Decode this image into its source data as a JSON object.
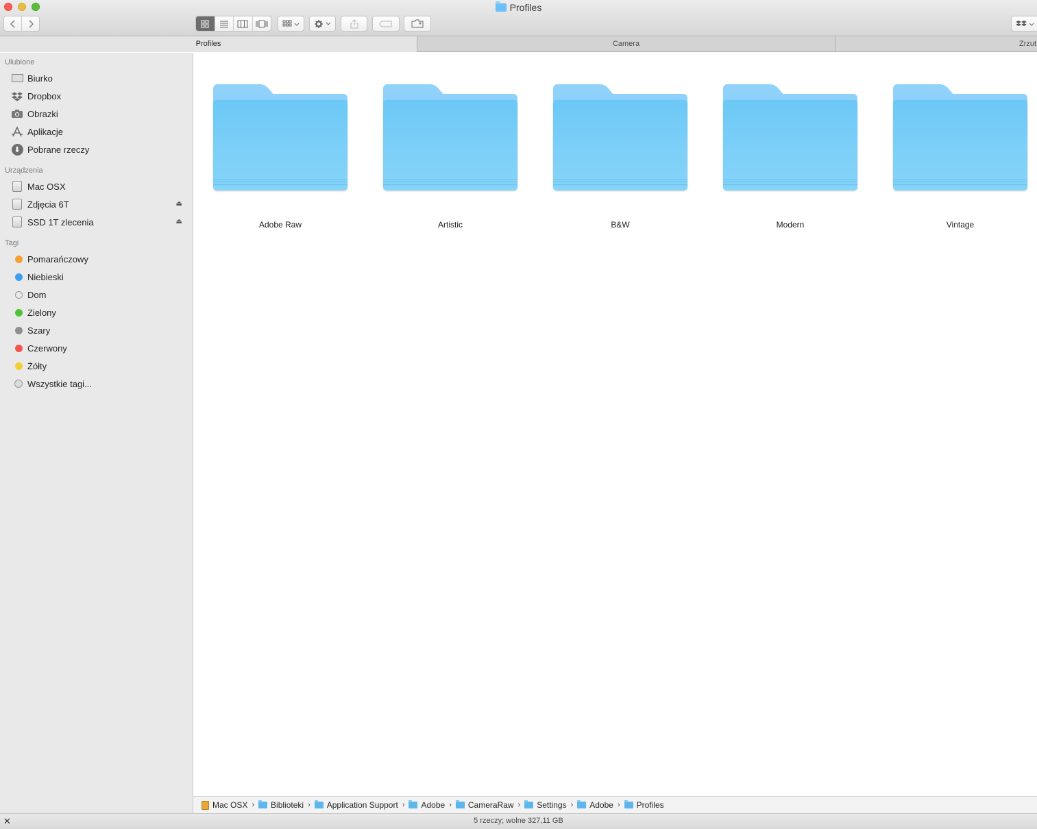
{
  "window": {
    "title": "Profiles"
  },
  "tabs": [
    {
      "label": "Profiles",
      "active": true
    },
    {
      "label": "Camera",
      "active": false
    },
    {
      "label": "Zrzut",
      "active": false
    }
  ],
  "sidebar": {
    "favorites_title": "Ulubione",
    "favorites": [
      {
        "label": "Biurko",
        "icon": "desktop-icon"
      },
      {
        "label": "Dropbox",
        "icon": "dropbox-icon"
      },
      {
        "label": "Obrazki",
        "icon": "camera-icon"
      },
      {
        "label": "Aplikacje",
        "icon": "applications-icon"
      },
      {
        "label": "Pobrane rzeczy",
        "icon": "download-icon"
      }
    ],
    "devices_title": "Urządzenia",
    "devices": [
      {
        "label": "Mac OSX",
        "ejectable": false
      },
      {
        "label": "Zdjęcia 6T",
        "ejectable": true
      },
      {
        "label": "SSD 1T zlecenia",
        "ejectable": true
      }
    ],
    "tags_title": "Tagi",
    "tags": [
      {
        "label": "Pomarańczowy",
        "color": "#f5a031"
      },
      {
        "label": "Niebieski",
        "color": "#3b9ef2"
      },
      {
        "label": "Dom",
        "color": "none"
      },
      {
        "label": "Zielony",
        "color": "#53c23b"
      },
      {
        "label": "Szary",
        "color": "#8f8f8f"
      },
      {
        "label": "Czerwony",
        "color": "#f2564f"
      },
      {
        "label": "Żółty",
        "color": "#f5cd34"
      },
      {
        "label": "Wszystkie tagi...",
        "color": "all"
      }
    ]
  },
  "folders": [
    {
      "name": "Adobe Raw"
    },
    {
      "name": "Artistic"
    },
    {
      "name": "B&W"
    },
    {
      "name": "Modern"
    },
    {
      "name": "Vintage"
    }
  ],
  "path": [
    {
      "label": "Mac OSX",
      "icon": "drive"
    },
    {
      "label": "Biblioteki",
      "icon": "folder"
    },
    {
      "label": "Application Support",
      "icon": "folder"
    },
    {
      "label": "Adobe",
      "icon": "folder"
    },
    {
      "label": "CameraRaw",
      "icon": "folder"
    },
    {
      "label": "Settings",
      "icon": "folder"
    },
    {
      "label": "Adobe",
      "icon": "folder"
    },
    {
      "label": "Profiles",
      "icon": "folder"
    }
  ],
  "status": {
    "text": "5 rzeczy; wolne 327,11 GB"
  },
  "toolbar": {
    "back_icon": "‹",
    "forward_icon": "›",
    "chevron": "⌄"
  }
}
